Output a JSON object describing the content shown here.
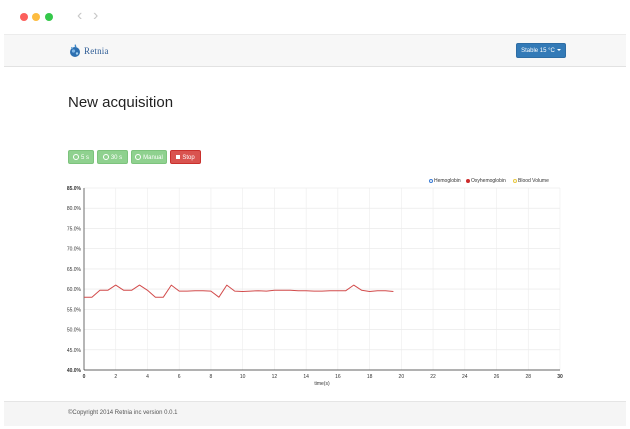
{
  "window": {
    "controls": [
      "close",
      "minimize",
      "maximize"
    ],
    "back_icon": "chevron-left-icon",
    "forward_icon": "chevron-right-icon"
  },
  "navbar": {
    "logo_text": "Retnia",
    "status_button": "Stable 15 °C"
  },
  "main": {
    "title": "New acquisition",
    "buttons": [
      {
        "label": "5 s",
        "icon": "clock-icon"
      },
      {
        "label": "30 s",
        "icon": "clock-icon"
      },
      {
        "label": "Manual",
        "icon": "clock-icon"
      },
      {
        "label": "Stop",
        "icon": "stop-icon"
      }
    ]
  },
  "chart_data": {
    "type": "line",
    "xlabel": "time(s)",
    "ylabel": "",
    "xlim": [
      0,
      30
    ],
    "ylim": [
      40,
      85
    ],
    "x_ticks": [
      "0",
      "2",
      "4",
      "6",
      "8",
      "10",
      "12",
      "14",
      "16",
      "18",
      "20",
      "22",
      "24",
      "26",
      "28",
      "30"
    ],
    "y_ticks": [
      "85.0%",
      "80.0%",
      "75.0%",
      "70.0%",
      "65.0%",
      "60.0%",
      "55.0%",
      "50.0%",
      "45.0%",
      "40.0%"
    ],
    "grid": true,
    "legend_position": "top-right",
    "legend": [
      {
        "name": "Hemoglobin",
        "color": "#3a7bd5",
        "filled": false
      },
      {
        "name": "Oxyhemoglobin",
        "color": "#cc2b2b",
        "filled": true
      },
      {
        "name": "Blood Volume",
        "color": "#e8c840",
        "filled": false
      }
    ],
    "series": [
      {
        "name": "Oxyhemoglobin",
        "color": "#d24b4b",
        "x": [
          0,
          0.5,
          1,
          1.5,
          2,
          2.5,
          3,
          3.5,
          4,
          4.5,
          5,
          5.5,
          6,
          6.5,
          7,
          7.5,
          8,
          8.5,
          9,
          9.5,
          10,
          10.5,
          11,
          11.5,
          12,
          12.5,
          13,
          13.5,
          14,
          14.5,
          15,
          15.5,
          16,
          16.5,
          17,
          17.5,
          18,
          18.5,
          19,
          19.5
        ],
        "y": [
          58,
          58,
          59.7,
          59.7,
          61,
          59.7,
          59.7,
          61,
          59.7,
          58,
          58,
          61,
          59.5,
          59.5,
          59.6,
          59.6,
          59.5,
          58,
          61,
          59.5,
          59.4,
          59.5,
          59.6,
          59.5,
          59.7,
          59.7,
          59.7,
          59.6,
          59.6,
          59.5,
          59.5,
          59.6,
          59.6,
          59.6,
          61,
          59.7,
          59.4,
          59.6,
          59.6,
          59.4
        ]
      }
    ]
  },
  "footer": {
    "text": "©Copyright 2014 Retnia inc version 0.0.1"
  }
}
